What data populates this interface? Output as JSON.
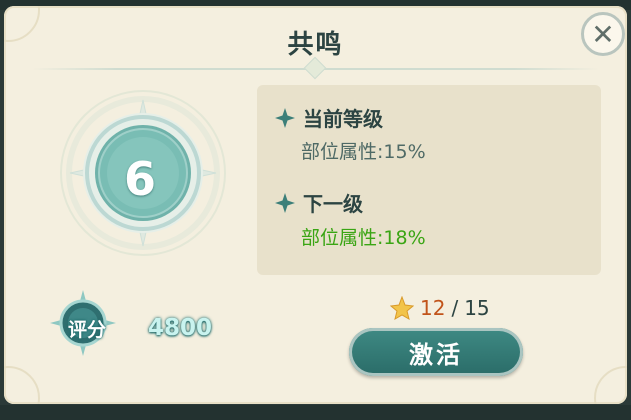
{
  "dialog": {
    "title": "共鸣",
    "close_icon": "close-icon"
  },
  "level": {
    "value": "6"
  },
  "info": {
    "current_heading": "当前等级",
    "current_value": "部位属性:15%",
    "next_heading": "下一级",
    "next_value": "部位属性:18%"
  },
  "score": {
    "label": "评分",
    "value": "4800"
  },
  "cost": {
    "have": "12",
    "separator": "/",
    "need": "15",
    "icon": "star-icon"
  },
  "actions": {
    "activate_label": "激活"
  },
  "colors": {
    "panel_bg": "#f4efdf",
    "accent_teal": "#2a6c68",
    "next_value_green": "#3aa514",
    "cost_orange": "#c1541a"
  }
}
